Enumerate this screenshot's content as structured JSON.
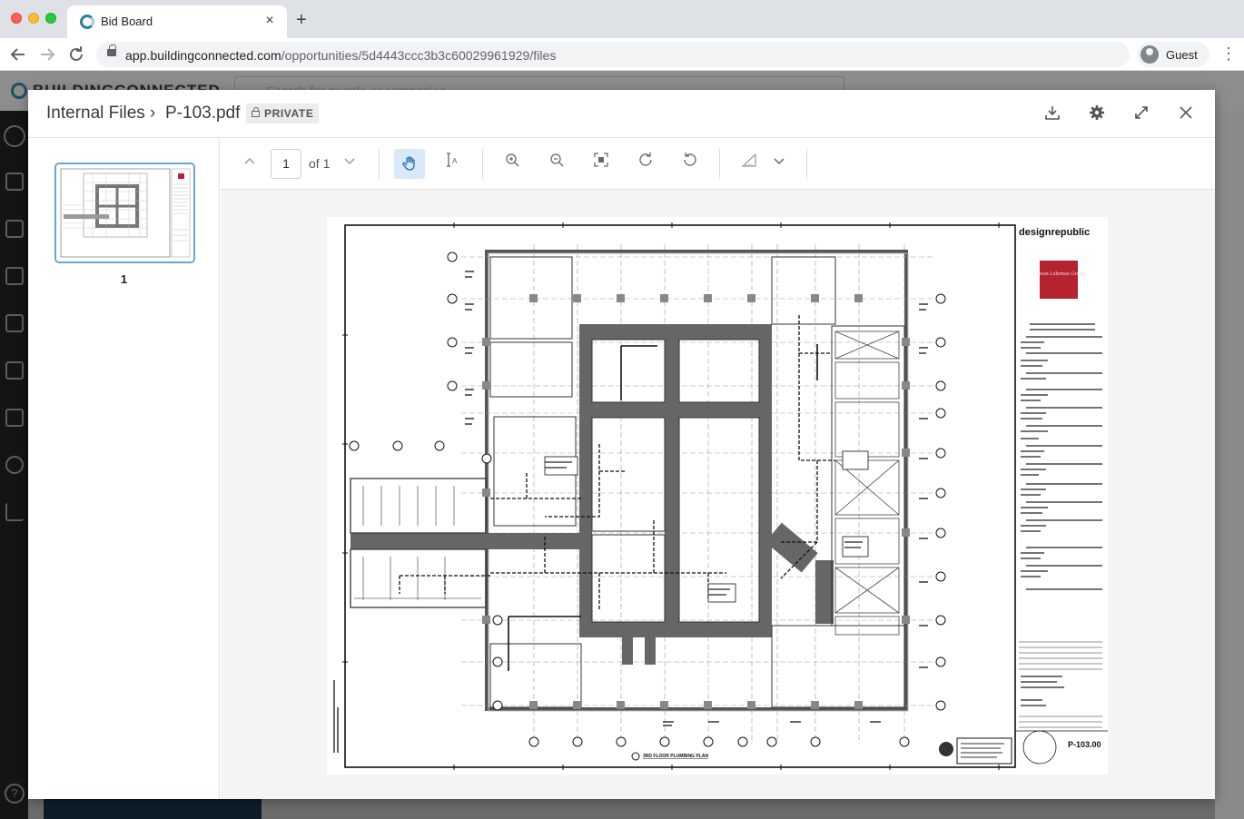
{
  "browser": {
    "tab_title": "Bid Board",
    "tab_close": "×",
    "new_tab": "+",
    "url_host": "app.buildingconnected.com",
    "url_path": "/opportunities/5d4443ccc3b3c60029961929/files",
    "profile_label": "Guest",
    "back_icon": "arrow-left-icon",
    "forward_icon": "arrow-right-icon",
    "reload_icon": "reload-icon"
  },
  "app": {
    "logo_text": "BUILDINGCONNECTED",
    "search_placeholder": "Search for people or companies"
  },
  "modal": {
    "breadcrumb_root": "Internal Files",
    "breadcrumb_sep": "›",
    "file_name": "P-103.pdf",
    "badge": "PRIVATE",
    "actions": [
      "download-icon",
      "gear-icon",
      "expand-icon",
      "close-icon"
    ]
  },
  "viewer": {
    "page_current": "1",
    "page_of": "of 1",
    "thumbnail_label": "1",
    "tools": [
      "chevron-up-icon",
      "chevron-down-icon",
      "hand-tool-icon",
      "text-select-icon",
      "zoom-in-icon",
      "zoom-out-icon",
      "fit-page-icon",
      "rotate-clockwise-icon",
      "rotate-counterclockwise-icon",
      "measure-icon",
      "dropdown-chevron-icon"
    ],
    "active_tool": "hand-tool-icon"
  },
  "drawing": {
    "firm": "designrepublic",
    "client_logo": "Gerson Lehrman Group",
    "title": "3RD FLOOR PLUMBING PLAN",
    "sheet_number": "P-103.00"
  },
  "colors": {
    "accent_blue": "#68a6d8",
    "active_tool_bg": "#d9e9f8",
    "client_red": "#b5232f",
    "core_fill": "#666666"
  }
}
